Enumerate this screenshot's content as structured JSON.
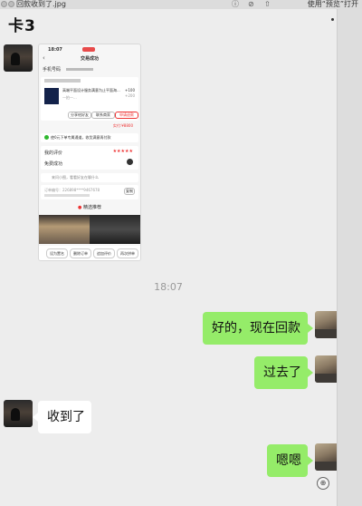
{
  "titlebar": {
    "filename": "回款收到了.jpg",
    "open_with": "使用“预览”打开"
  },
  "chat": {
    "title": "卡3",
    "timestamp": "18:07"
  },
  "screenshot": {
    "status_time": "18:07",
    "header": "交易成功",
    "phone_label": "手机号码",
    "price1": "+100",
    "price2": "+200",
    "product": "高端平面设计服务满意为止平面海...",
    "shop": "一拍一...",
    "btn_share": "分享给好友",
    "btn_contact": "联系商家",
    "btn_refund": "申请退款",
    "total_label": "实付:",
    "total_value": "¥8800",
    "pay_note": "使0元下单专属通道，收货满意再付款",
    "rating_label": "我的评价",
    "stars": "★★★★★",
    "free_label": "免费成功",
    "help_text": "来问小图，看看好友在聊什么",
    "order_no_label": "订单编号：",
    "order_no": "226898****9467678",
    "copy": "复制",
    "recommend": "精选推荐",
    "actions": [
      "设为置名",
      "删除订单",
      "追加评价",
      "再次拼单"
    ]
  },
  "messages": [
    {
      "side": "me",
      "text": "好的，现在回款"
    },
    {
      "side": "me",
      "text": "过去了"
    },
    {
      "side": "other",
      "text": "收到了"
    },
    {
      "side": "me",
      "text": "嗯嗯"
    }
  ],
  "colors": {
    "my_bubble": "#95ec69",
    "other_bubble": "#ffffff",
    "background": "#ededed"
  }
}
